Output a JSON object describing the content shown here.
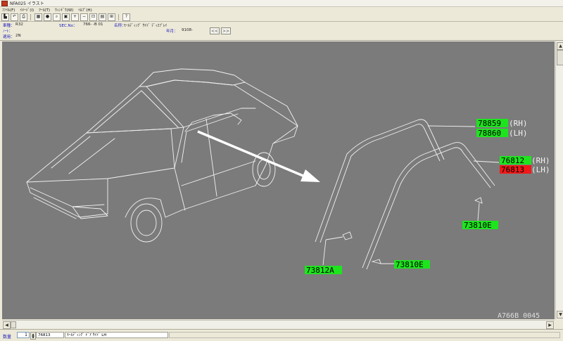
{
  "window": {
    "title": "NFA025 イラスト"
  },
  "menu": {
    "items": [
      "ﾌｧｲﾙ(F)",
      "ｲﾒｰｼﾞ(I)",
      "ﾂｰﾙ(T)",
      "ｳｨﾝﾄﾞｳ(W)",
      "ﾍﾙﾌﾟ(H)"
    ]
  },
  "info": {
    "model_label": "車種：",
    "model_value": "R32",
    "note_label": "ﾉｰﾄ：",
    "applicable_label": "適用：",
    "applicable_value": "2N",
    "sec_label": "SEC.No：",
    "sec_value": "766- -B 01",
    "name_label": "名称：",
    "name_value": "ﾓｰﾙﾃﾞｨﾝｸﾞ ｻｲﾄﾞ ﾃﾞｨｽﾌﾟﾚｲ",
    "date_label": "年月：",
    "date_value": "9108-",
    "prev_btn": "<<",
    "next_btn": ">>"
  },
  "callouts": [
    {
      "code": "78859",
      "side": "(RH)",
      "highlight": "#1ee41e"
    },
    {
      "code": "78860",
      "side": "(LH)",
      "highlight": "#1ee41e"
    },
    {
      "code": "76812",
      "side": "(RH)",
      "highlight": "#1ee41e"
    },
    {
      "code": "76813",
      "side": "(LH)",
      "highlight": "#f01818"
    },
    {
      "code": "73810E",
      "side": "",
      "highlight": "#1ee41e"
    },
    {
      "code": "73812A",
      "side": "",
      "highlight": "#1ee41e"
    },
    {
      "code": "73810E",
      "side": "",
      "highlight": "#1ee41e"
    }
  ],
  "drawing_id": "A766B 0045",
  "statusbar": {
    "qty_label": "数量",
    "qty_value": "1",
    "part_no": "76813",
    "part_desc": "ﾓｰﾙﾃﾞｨﾝｸﾞ ﾄﾞｱ ｻｲﾄﾞ LH"
  },
  "colors": {
    "viewer_bg": "#7b7b7b",
    "line_art": "#f2f2f2",
    "highlight_green": "#1ee41e",
    "highlight_red": "#f01818",
    "label_blue": "#1a1ab8"
  },
  "icons": [
    "save-icon",
    "undo-icon",
    "print-icon",
    "grid-icon",
    "circle-icon",
    "search-icon",
    "image-icon",
    "zoom-in-icon",
    "zoom-out-icon",
    "select-icon",
    "ruler-icon",
    "fit-icon",
    "help-icon"
  ]
}
